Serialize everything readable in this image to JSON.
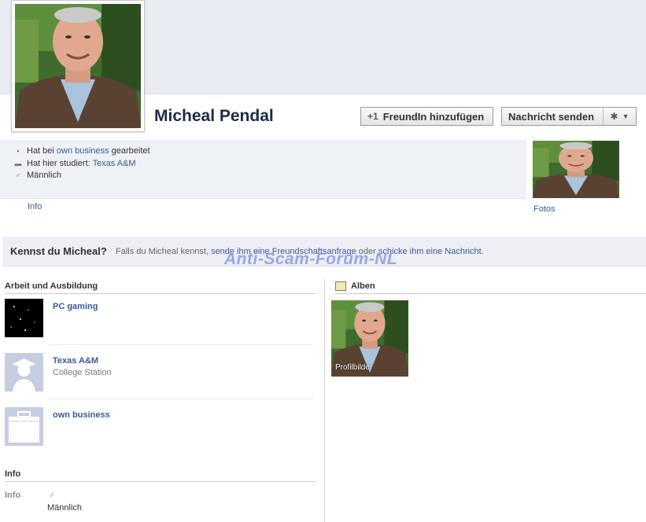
{
  "profile": {
    "name": "Micheal Pendal",
    "add_friend_label": "FreundIn hinzufügen",
    "send_message_label": "Nachricht senden"
  },
  "info_summary": {
    "work_prefix": "Hat bei",
    "work_link": "own business",
    "work_suffix": "gearbeitet",
    "study_prefix": "Hat hier studiert:",
    "study_link": "Texas A&M",
    "gender": "Männlich"
  },
  "tabs": {
    "info": "Info",
    "fotos": "Fotos"
  },
  "know_bar": {
    "question": "Kennst du Micheal?",
    "text_1": "Falls du Micheal kennst,",
    "link_1": "sende ihm eine Freundschaftsanfrage",
    "text_2": "oder",
    "link_2": "schicke ihm eine Nachricht",
    "text_3": "."
  },
  "watermark": "Anti-Scam-Forum-NL",
  "work_section": {
    "heading": "Arbeit und Ausbildung",
    "items": [
      {
        "title": "PC gaming",
        "subtitle": ""
      },
      {
        "title": "Texas A&M",
        "subtitle": "College Station"
      },
      {
        "title": "own business",
        "subtitle": ""
      }
    ]
  },
  "albums": {
    "heading": "Alben",
    "items": [
      {
        "caption": "Profilbilder"
      }
    ]
  },
  "info_section": {
    "heading": "Info",
    "label": "Info",
    "value": "Männlich"
  },
  "colors": {
    "link": "#3b5998",
    "name": "#1c2a47",
    "watermark": "#8c98e6"
  }
}
